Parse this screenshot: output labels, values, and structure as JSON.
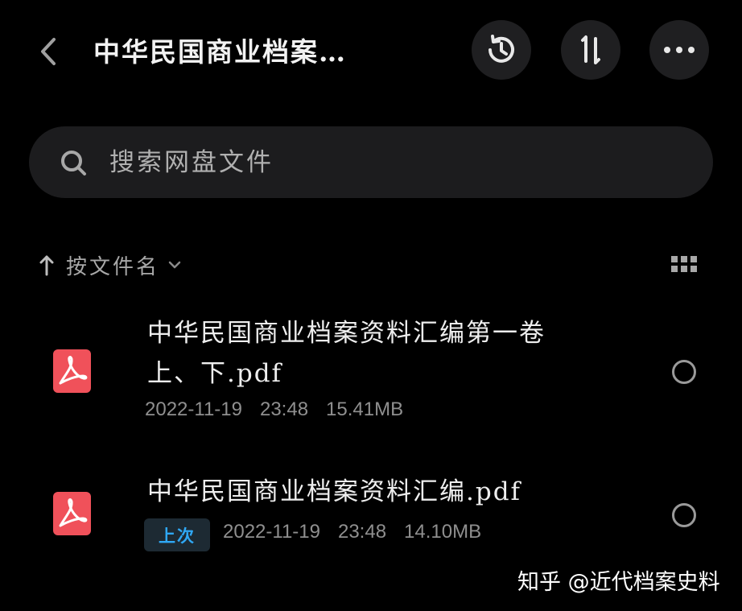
{
  "header": {
    "title": "中华民国商业档案…",
    "back_icon": "chevron-left-icon",
    "actions": [
      {
        "name": "history-icon"
      },
      {
        "name": "sort-order-icon"
      },
      {
        "name": "more-icon"
      }
    ]
  },
  "search": {
    "placeholder": "搜索网盘文件",
    "icon": "search-icon"
  },
  "sort": {
    "label": "按文件名",
    "direction_icon": "arrow-up-icon",
    "dropdown_icon": "chevron-down-icon",
    "view_icon": "grid-view-icon"
  },
  "files": [
    {
      "name": "中华民国商业档案资料汇编第一卷上、下.pdf",
      "date": "2022-11-19",
      "time": "23:48",
      "size": "15.41MB",
      "badge": null,
      "icon": "pdf-file-icon"
    },
    {
      "name": "中华民国商业档案资料汇编.pdf",
      "date": "2022-11-19",
      "time": "23:48",
      "size": "14.10MB",
      "badge": "上次",
      "icon": "pdf-file-icon"
    }
  ],
  "watermark": "知乎 @近代档案史料",
  "colors": {
    "background": "#000000",
    "surface": "#1c1c1e",
    "pdf_red": "#f0515a",
    "badge_text": "#2fa8f5"
  }
}
